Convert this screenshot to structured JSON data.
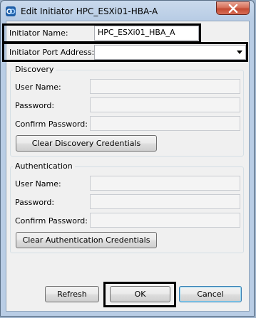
{
  "window": {
    "title": "Edit Initiator HPC_ESXi01-HBA-A",
    "icons": {
      "app": "storage-manager-icon",
      "close": "close-x-icon"
    }
  },
  "initiator": {
    "name_label": "Initiator Name:",
    "name_value": "HPC_ESXi01_HBA_A",
    "port_label": "Initiator Port Address:",
    "port_value": ""
  },
  "discovery": {
    "title": "Discovery",
    "user_label": "User Name:",
    "password_label": "Password:",
    "confirm_label": "Confirm Password:",
    "clear_button": "Clear Discovery Credentials"
  },
  "authentication": {
    "title": "Authentication",
    "user_label": "User Name:",
    "password_label": "Password:",
    "confirm_label": "Confirm Password:",
    "clear_button": "Clear Authentication Credentials"
  },
  "footer": {
    "refresh": "Refresh",
    "ok": "OK",
    "cancel": "Cancel"
  },
  "colors": {
    "highlight_box": "#000000",
    "default_button_border": "#3c7fb1",
    "close_button": "#c34b33"
  }
}
